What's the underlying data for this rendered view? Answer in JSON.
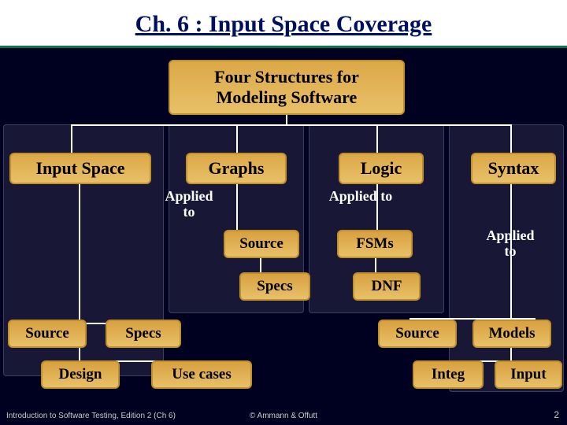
{
  "title": "Ch. 6 : Input Space Coverage",
  "top": {
    "line1": "Four Structures for",
    "line2": "Modeling Software"
  },
  "main": {
    "input_space": "Input Space",
    "graphs": "Graphs",
    "logic": "Logic",
    "syntax": "Syntax"
  },
  "applied": {
    "label_single": "Applied to",
    "label_split1": "Applied",
    "label_split2": "to"
  },
  "graphs_children": {
    "source": "Source",
    "specs": "Specs"
  },
  "logic_children": {
    "fsms": "FSMs",
    "dnf": "DNF"
  },
  "input_space_children": {
    "source": "Source",
    "specs": "Specs",
    "design": "Design",
    "use_cases": "Use cases"
  },
  "syntax_children": {
    "source": "Source",
    "models": "Models",
    "integ": "Integ",
    "input": "Input"
  },
  "footer": {
    "left": "Introduction to Software Testing, Edition 2 (Ch 6)",
    "center": "© Ammann & Offutt",
    "right": "2"
  }
}
